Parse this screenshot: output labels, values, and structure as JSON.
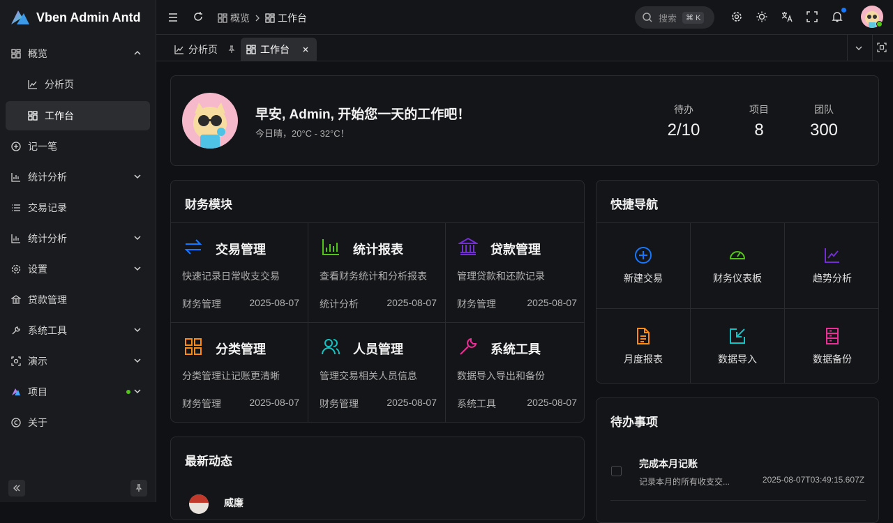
{
  "app": {
    "title": "Vben Admin Antd"
  },
  "sidebar": {
    "items": [
      {
        "label": "概览"
      },
      {
        "label": "分析页"
      },
      {
        "label": "工作台"
      },
      {
        "label": "记一笔"
      },
      {
        "label": "统计分析"
      },
      {
        "label": "交易记录"
      },
      {
        "label": "统计分析"
      },
      {
        "label": "设置"
      },
      {
        "label": "贷款管理"
      },
      {
        "label": "系统工具"
      },
      {
        "label": "演示"
      },
      {
        "label": "项目"
      },
      {
        "label": "关于"
      }
    ]
  },
  "header": {
    "breadcrumb": [
      "概览",
      "工作台"
    ],
    "search_placeholder": "搜索",
    "search_shortcut": "⌘ K"
  },
  "tabs": [
    {
      "label": "分析页"
    },
    {
      "label": "工作台"
    }
  ],
  "welcome": {
    "greeting": "早安, Admin, 开始您一天的工作吧！",
    "weather": "今日晴，20°C - 32°C！",
    "stats": [
      {
        "label": "待办",
        "value": "2/10"
      },
      {
        "label": "项目",
        "value": "8"
      },
      {
        "label": "团队",
        "value": "300"
      }
    ]
  },
  "finance": {
    "title": "财务模块",
    "modules": [
      {
        "title": "交易管理",
        "desc": "快速记录日常收支交易",
        "category": "财务管理",
        "date": "2025-08-07",
        "icon": "exchange-icon",
        "color": "#1677ff"
      },
      {
        "title": "统计报表",
        "desc": "查看财务统计和分析报表",
        "category": "统计分析",
        "date": "2025-08-07",
        "icon": "bar-chart-icon",
        "color": "#52c41a"
      },
      {
        "title": "贷款管理",
        "desc": "管理贷款和还款记录",
        "category": "财务管理",
        "date": "2025-08-07",
        "icon": "bank-icon",
        "color": "#722ed1"
      },
      {
        "title": "分类管理",
        "desc": "分类管理让记账更清晰",
        "category": "财务管理",
        "date": "2025-08-07",
        "icon": "grid-icon",
        "color": "#fa8c16"
      },
      {
        "title": "人员管理",
        "desc": "管理交易相关人员信息",
        "category": "财务管理",
        "date": "2025-08-07",
        "icon": "users-icon",
        "color": "#13c2c2"
      },
      {
        "title": "系统工具",
        "desc": "数据导入导出和备份",
        "category": "系统工具",
        "date": "2025-08-07",
        "icon": "wrench-icon",
        "color": "#eb2f96"
      }
    ]
  },
  "quicknav": {
    "title": "快捷导航",
    "items": [
      {
        "label": "新建交易",
        "icon": "plus-circle-icon",
        "color": "#1677ff"
      },
      {
        "label": "财务仪表板",
        "icon": "gauge-icon",
        "color": "#52c41a"
      },
      {
        "label": "趋势分析",
        "icon": "trend-icon",
        "color": "#722ed1"
      },
      {
        "label": "月度报表",
        "icon": "file-icon",
        "color": "#fa8c16"
      },
      {
        "label": "数据导入",
        "icon": "import-icon",
        "color": "#13c2c2"
      },
      {
        "label": "数据备份",
        "icon": "database-icon",
        "color": "#eb2f96"
      }
    ]
  },
  "activity": {
    "title": "最新动态",
    "first_user": "威廉"
  },
  "todo": {
    "title": "待办事项",
    "items": [
      {
        "title": "完成本月记账",
        "desc": "记录本月的所有收支交...",
        "time": "2025-08-07T03:49:15.607Z"
      }
    ]
  }
}
